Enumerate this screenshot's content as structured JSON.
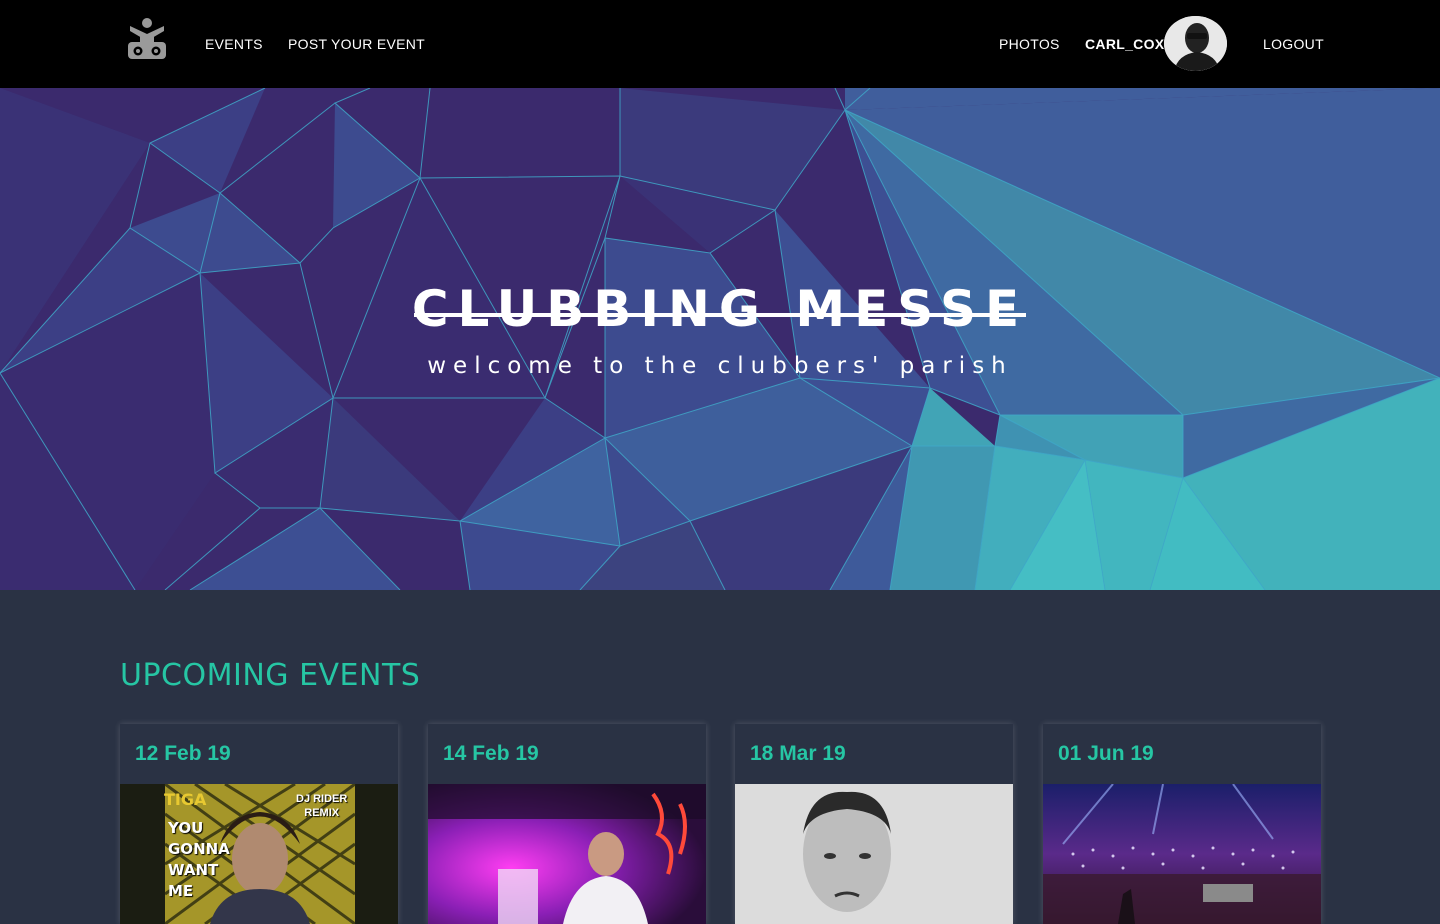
{
  "nav": {
    "logo_icon": "dj-logo-icon",
    "events": "EVENTS",
    "post_event": "POST YOUR EVENT",
    "photos": "PHOTOS",
    "username": "CARL_COX",
    "logout": "LOGOUT"
  },
  "hero": {
    "title": "CLUBBING MESSE",
    "subtitle": "welcome to the clubbers' parish"
  },
  "upcoming": {
    "title": "UPCOMING EVENTS",
    "cards": [
      {
        "date": "12 Feb 19",
        "image_text": [
          "TIGA",
          "YOU",
          "GONNA",
          "WANT",
          "ME",
          "DJ RIDER",
          "REMIX"
        ]
      },
      {
        "date": "14 Feb 19"
      },
      {
        "date": "18 Mar 19"
      },
      {
        "date": "01 Jun 19"
      }
    ]
  },
  "colors": {
    "accent": "#26c6a4",
    "nav_bg": "#000000",
    "section_bg": "#2a3244"
  }
}
